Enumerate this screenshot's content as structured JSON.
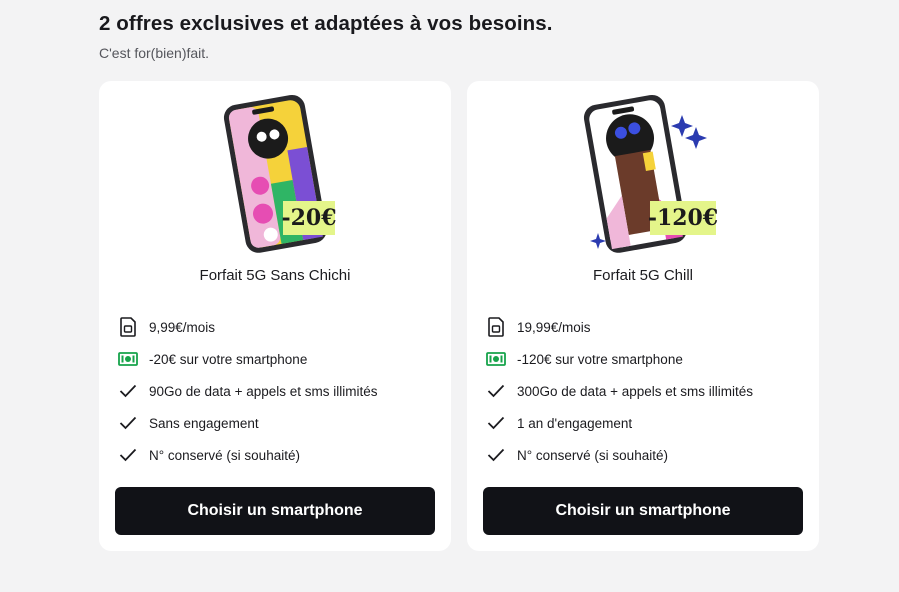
{
  "header": {
    "title": "2 offres exclusives et adaptées à vos besoins.",
    "subtitle": "C'est for(bien)fait."
  },
  "offers": [
    {
      "name": "Forfait 5G Sans Chichi",
      "discount_badge": "-20€",
      "features": [
        {
          "icon": "sim-card-icon",
          "text": "9,99€/mois"
        },
        {
          "icon": "banknote-icon",
          "text": "-20€ sur votre smartphone"
        },
        {
          "icon": "check-icon",
          "text": "90Go de data + appels et sms illimités"
        },
        {
          "icon": "check-icon",
          "text": "Sans engagement"
        },
        {
          "icon": "check-icon",
          "text": "N° conservé (si souhaité)"
        }
      ],
      "cta": "Choisir un smartphone"
    },
    {
      "name": "Forfait 5G Chill",
      "discount_badge": "-120€",
      "features": [
        {
          "icon": "sim-card-icon",
          "text": "19,99€/mois"
        },
        {
          "icon": "banknote-icon",
          "text": "-120€ sur votre smartphone"
        },
        {
          "icon": "check-icon",
          "text": "300Go de data + appels et sms illimités"
        },
        {
          "icon": "check-icon",
          "text": "1 an d'engagement"
        },
        {
          "icon": "check-icon",
          "text": "N° conservé (si souhaité)"
        }
      ],
      "cta": "Choisir un smartphone"
    }
  ],
  "colors": {
    "background": "#f3f3f4",
    "card": "#ffffff",
    "button": "#111217",
    "badge": "#e4f58a",
    "banknote": "#16a34a",
    "sparkle": "#2b3bb0"
  }
}
